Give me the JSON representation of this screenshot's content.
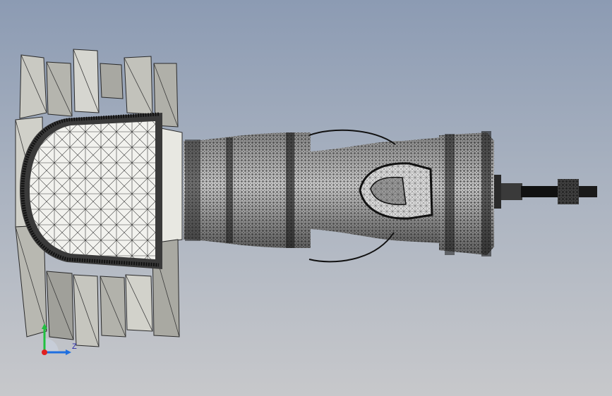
{
  "viewport": {
    "background_top": "#8c9bb3",
    "background_bottom": "#c7c8cb",
    "mesh_color": "#1a1a1a",
    "panel_light": "#e6e6e0",
    "panel_mid": "#b8b8b0",
    "panel_dark": "#8e8e88"
  },
  "triad": {
    "z_label": "Z",
    "x_axis_color": "#1f6fe0",
    "y_axis_color": "#20c040",
    "origin_color": "#e02020"
  }
}
